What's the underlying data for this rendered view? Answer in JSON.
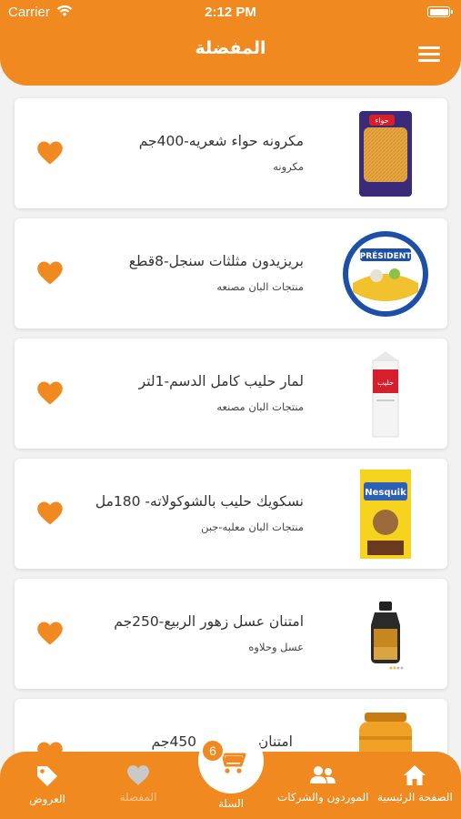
{
  "status": {
    "carrier": "Carrier",
    "time": "2:12 PM"
  },
  "header": {
    "title": "المفضلة"
  },
  "favorites": [
    {
      "name": "مكرونه حواء شعريه-400جم",
      "category": "مكرونه",
      "image": "pasta-bag"
    },
    {
      "name": "بريزيدون مثلثات سنجل-8قطع",
      "category": "منتجات البان مصنعه",
      "image": "cheese-box"
    },
    {
      "name": "لمار حليب كامل الدسم-1لتر",
      "category": "منتجات البان مصنعه",
      "image": "milk-carton"
    },
    {
      "name": "نسكويك حليب بالشوكولاته- 180مل",
      "category": "منتجات البان معلبه-جبن",
      "image": "nesquik-box"
    },
    {
      "name": "امتنان عسل زهور الربيع-250جم",
      "category": "عسل وحلاوه",
      "image": "honey-jar"
    },
    {
      "name": "امتنان",
      "name_suffix": "450جم",
      "category": "",
      "image": "honey-jar-large"
    }
  ],
  "bottom_nav": {
    "home": "الصفحة الرئيسية",
    "suppliers": "الموردون والشركات",
    "cart": "السلة",
    "cart_count": "6",
    "favorites": "المفضلة",
    "offers": "العروض"
  },
  "colors": {
    "accent": "#f0891f",
    "background": "#f2f2f2"
  }
}
